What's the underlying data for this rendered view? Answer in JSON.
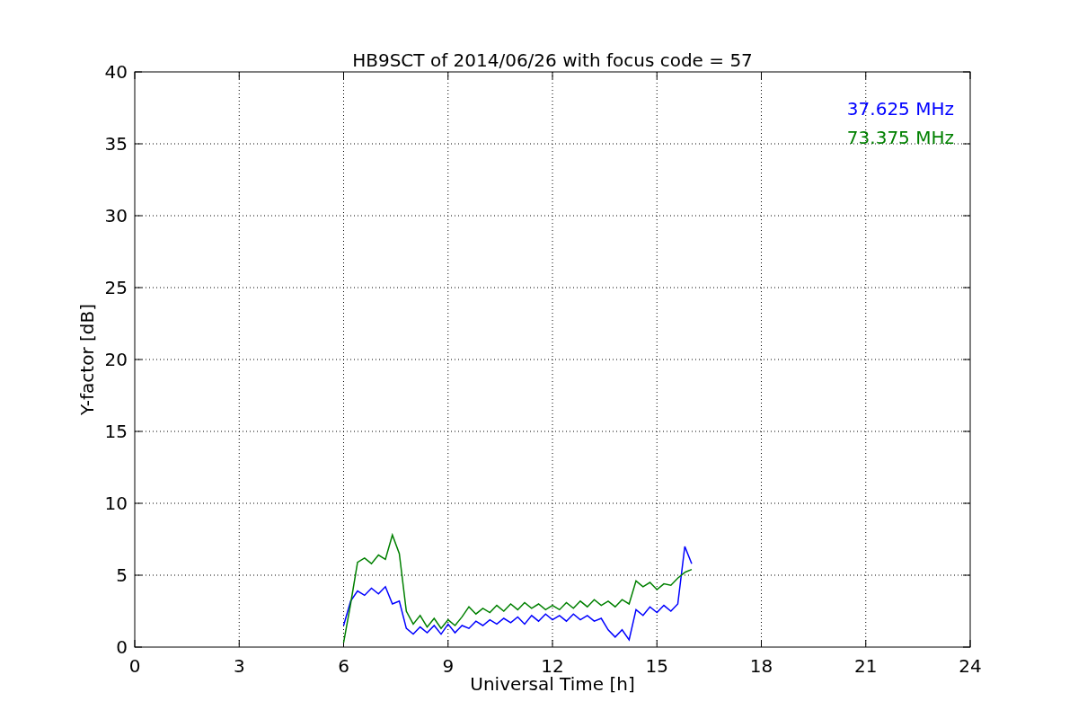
{
  "chart_data": {
    "type": "line",
    "title": "HB9SCT of 2014/06/26 with focus code = 57",
    "xlabel": "Universal Time [h]",
    "ylabel": "Y-factor [dB]",
    "x": [
      6.0,
      6.2,
      6.4,
      6.6,
      6.8,
      7.0,
      7.2,
      7.4,
      7.6,
      7.8,
      8.0,
      8.2,
      8.4,
      8.6,
      8.8,
      9.0,
      9.2,
      9.4,
      9.6,
      9.8,
      10.0,
      10.2,
      10.4,
      10.6,
      10.8,
      11.0,
      11.2,
      11.4,
      11.6,
      11.8,
      12.0,
      12.2,
      12.4,
      12.6,
      12.8,
      13.0,
      13.2,
      13.4,
      13.6,
      13.8,
      14.0,
      14.2,
      14.4,
      14.6,
      14.8,
      15.0,
      15.2,
      15.4,
      15.6,
      15.8,
      16.0
    ],
    "series": [
      {
        "name": "37.625 MHz",
        "color": "#0000ff",
        "values": [
          1.5,
          3.2,
          3.9,
          3.6,
          4.1,
          3.7,
          4.2,
          3.0,
          3.2,
          1.3,
          0.9,
          1.4,
          1.0,
          1.5,
          0.9,
          1.6,
          1.0,
          1.5,
          1.3,
          1.8,
          1.5,
          1.9,
          1.6,
          2.0,
          1.7,
          2.1,
          1.6,
          2.2,
          1.8,
          2.3,
          1.9,
          2.2,
          1.8,
          2.3,
          1.9,
          2.2,
          1.8,
          2.0,
          1.2,
          0.7,
          1.2,
          0.5,
          2.6,
          2.2,
          2.8,
          2.4,
          2.9,
          2.5,
          3.0,
          7.0,
          5.8
        ]
      },
      {
        "name": "73.375 MHz",
        "color": "#008000",
        "values": [
          0.3,
          3.0,
          5.9,
          6.2,
          5.8,
          6.4,
          6.1,
          7.8,
          6.5,
          2.5,
          1.6,
          2.2,
          1.4,
          2.0,
          1.3,
          1.9,
          1.5,
          2.1,
          2.8,
          2.3,
          2.7,
          2.4,
          2.9,
          2.5,
          3.0,
          2.6,
          3.1,
          2.7,
          3.0,
          2.6,
          2.9,
          2.6,
          3.1,
          2.7,
          3.2,
          2.8,
          3.3,
          2.9,
          3.2,
          2.8,
          3.3,
          3.0,
          4.6,
          4.2,
          4.5,
          4.0,
          4.4,
          4.3,
          4.8,
          5.2,
          5.4
        ]
      }
    ],
    "xlim": [
      0,
      24
    ],
    "ylim": [
      0,
      40
    ],
    "xticks": [
      0,
      3,
      6,
      9,
      12,
      15,
      18,
      21,
      24
    ],
    "yticks": [
      0,
      5,
      10,
      15,
      20,
      25,
      30,
      35,
      40
    ],
    "grid": true
  }
}
